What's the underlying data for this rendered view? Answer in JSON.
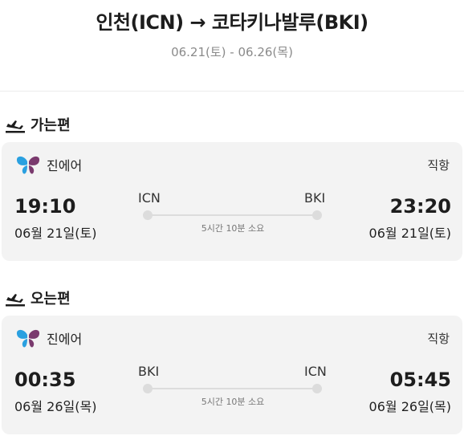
{
  "header": {
    "route": "인천(ICN) → 코타키나발루(BKI)",
    "dates": "06.21(토) - 06.26(목)"
  },
  "outbound": {
    "section_label": "가는편",
    "section_icon": "plane-departure-icon",
    "airline": "진에어",
    "airline_logo": "jinair-butterfly-logo",
    "stops": "직항",
    "depart_time": "19:10",
    "depart_date": "06월 21일(토)",
    "arrive_time": "23:20",
    "arrive_date": "06월 21일(토)",
    "from_code": "ICN",
    "to_code": "BKI",
    "duration": "5시간 10분 소요"
  },
  "inbound": {
    "section_label": "오는편",
    "section_icon": "plane-departure-icon",
    "airline": "진에어",
    "airline_logo": "jinair-butterfly-logo",
    "stops": "직항",
    "depart_time": "00:35",
    "depart_date": "06월 26일(목)",
    "arrive_time": "05:45",
    "arrive_date": "06월 26일(목)",
    "from_code": "BKI",
    "to_code": "ICN",
    "duration": "5시간 10분 소요"
  },
  "colors": {
    "card_bg": "#f3f3f3",
    "logo_blue": "#2aa0e0",
    "logo_purple": "#7a3a6e"
  }
}
